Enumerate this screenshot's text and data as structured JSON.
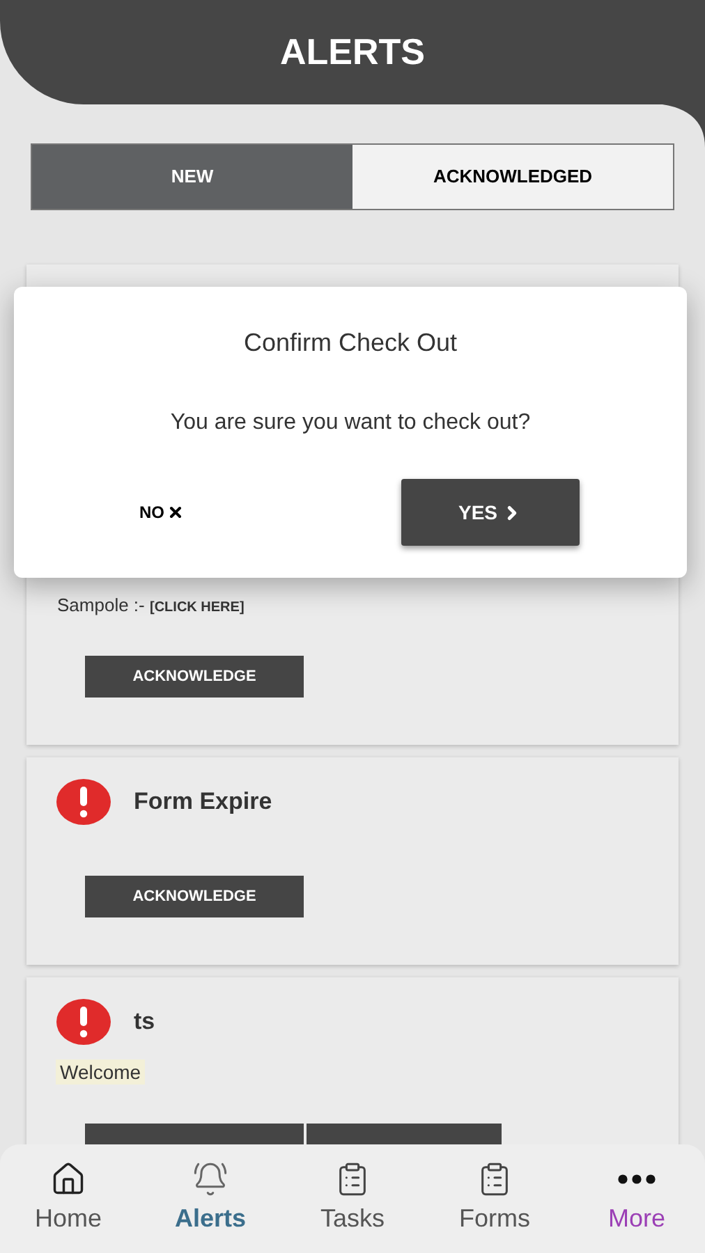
{
  "header": {
    "title": "ALERTS"
  },
  "tabs": [
    {
      "label": "NEW",
      "selected": true
    },
    {
      "label": "ACKNOWLEDGED",
      "selected": false
    }
  ],
  "alerts": [
    {
      "message": "Sampole :-",
      "link": "[CLICK HERE]",
      "actions": [
        {
          "kind": "button",
          "label": "ACKNOWLEDGE"
        }
      ]
    },
    {
      "title": "Form Expire",
      "actions": [
        {
          "kind": "button",
          "label": "ACKNOWLEDGE"
        }
      ]
    },
    {
      "title": "ts",
      "message": "Welcome",
      "highlighted": true,
      "actions": [
        {
          "kind": "button"
        },
        {
          "kind": "button"
        }
      ]
    }
  ],
  "dialog": {
    "title": "Confirm Check Out",
    "message": "You are sure you want to check out?",
    "no_button": "NO",
    "yes_button": "YES"
  },
  "bottom_nav": [
    {
      "label": "Home",
      "kind": "home",
      "selected": false,
      "color": "#555555"
    },
    {
      "label": "Alerts",
      "kind": "bell",
      "selected": true,
      "color": "#3b6e8c"
    },
    {
      "label": "Tasks",
      "kind": "clipboard",
      "selected": false,
      "color": "#555555"
    },
    {
      "label": "Forms",
      "kind": "clipboard",
      "selected": false,
      "color": "#555555"
    },
    {
      "label": "More",
      "kind": "dots",
      "selected": false,
      "color": "#9b3fb5"
    }
  ]
}
